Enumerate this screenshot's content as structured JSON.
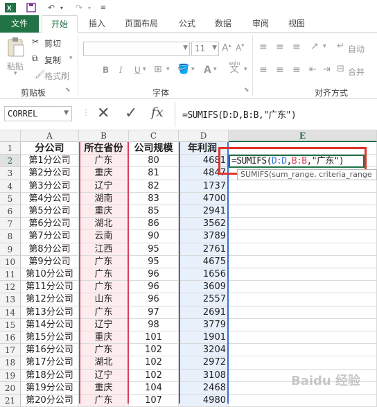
{
  "qat": {
    "excel_icon": "excel-logo-icon",
    "save_icon": "save-icon",
    "undo_icon": "undo-icon",
    "redo_icon": "redo-icon"
  },
  "tabs": {
    "file": "文件",
    "home": "开始",
    "insert": "插入",
    "layout": "页面布局",
    "formulas": "公式",
    "data": "数据",
    "review": "审阅",
    "view": "视图"
  },
  "ribbon": {
    "cut": "剪切",
    "copy": "复制",
    "format_painter": "格式刷",
    "paste": "粘贴",
    "clipboard_group": "剪贴板",
    "font_size": "11",
    "font_group": "字体",
    "bold": "B",
    "italic": "I",
    "underline": "U",
    "align_group": "对齐方式",
    "wrap": "自动",
    "merge": "合并",
    "wen": "wén",
    "wen_char": "文"
  },
  "formula_bar": {
    "name_box": "CORREL",
    "formula": "=SUMIFS(D:D,B:B,\"广东\")",
    "cancel": "✕",
    "enter": "✓",
    "fx": "fx"
  },
  "columns": [
    "A",
    "B",
    "C",
    "D",
    "E"
  ],
  "headers": {
    "a": "分公司",
    "b": "所在省份",
    "c": "公司规模",
    "d": "年利润"
  },
  "rows": [
    {
      "n": "1"
    },
    {
      "n": "2",
      "a": "第1分公司",
      "b": "广东",
      "c": "80",
      "d": "4681"
    },
    {
      "n": "3",
      "a": "第2分公司",
      "b": "重庆",
      "c": "81",
      "d": "4847"
    },
    {
      "n": "4",
      "a": "第3分公司",
      "b": "辽宁",
      "c": "82",
      "d": "1737"
    },
    {
      "n": "5",
      "a": "第4分公司",
      "b": "湖南",
      "c": "83",
      "d": "4700"
    },
    {
      "n": "6",
      "a": "第5分公司",
      "b": "重庆",
      "c": "85",
      "d": "2941"
    },
    {
      "n": "7",
      "a": "第6分公司",
      "b": "湖北",
      "c": "86",
      "d": "3562"
    },
    {
      "n": "8",
      "a": "第7分公司",
      "b": "云南",
      "c": "90",
      "d": "3789"
    },
    {
      "n": "9",
      "a": "第8分公司",
      "b": "江西",
      "c": "95",
      "d": "2761"
    },
    {
      "n": "10",
      "a": "第9分公司",
      "b": "广东",
      "c": "95",
      "d": "4675"
    },
    {
      "n": "11",
      "a": "第10分公司",
      "b": "广东",
      "c": "96",
      "d": "1656"
    },
    {
      "n": "12",
      "a": "第11分公司",
      "b": "广东",
      "c": "96",
      "d": "3609"
    },
    {
      "n": "13",
      "a": "第12分公司",
      "b": "山东",
      "c": "96",
      "d": "2557"
    },
    {
      "n": "14",
      "a": "第13分公司",
      "b": "广东",
      "c": "97",
      "d": "2691"
    },
    {
      "n": "15",
      "a": "第14分公司",
      "b": "辽宁",
      "c": "98",
      "d": "3779"
    },
    {
      "n": "16",
      "a": "第15分公司",
      "b": "重庆",
      "c": "101",
      "d": "1901"
    },
    {
      "n": "17",
      "a": "第16分公司",
      "b": "广东",
      "c": "102",
      "d": "3204"
    },
    {
      "n": "18",
      "a": "第17分公司",
      "b": "湖北",
      "c": "102",
      "d": "2972"
    },
    {
      "n": "19",
      "a": "第18分公司",
      "b": "辽宁",
      "c": "102",
      "d": "3108"
    },
    {
      "n": "20",
      "a": "第19分公司",
      "b": "重庆",
      "c": "104",
      "d": "2468"
    },
    {
      "n": "21",
      "a": "第20分公司",
      "b": "广东",
      "c": "107",
      "d": "4980"
    }
  ],
  "editing": {
    "p1": "=SUMIFS(",
    "p2": "D:D",
    "p3": ",",
    "p4": "B:B",
    "p5": ",\"广东\")",
    "tooltip": "SUMIFS(sum_range, criteria_range"
  },
  "colors": {
    "excel_green": "#217346",
    "d_ref": "#3b6fd6",
    "b_ref": "#d2435a",
    "highlight": "#e0342b"
  },
  "watermark": "Baidu 经验"
}
